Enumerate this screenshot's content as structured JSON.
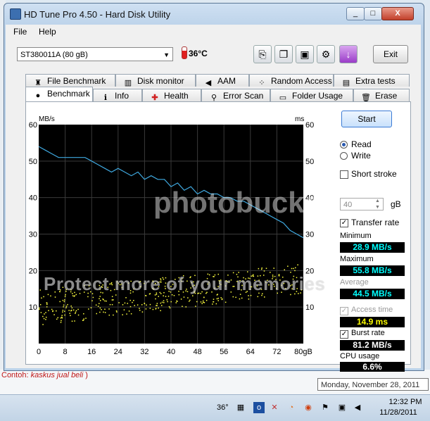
{
  "window": {
    "title": "HD Tune Pro 4.50 - Hard Disk Utility",
    "minimize_glyph": "_",
    "maximize_glyph": "□",
    "close_glyph": "X"
  },
  "menu": {
    "file": "File",
    "help": "Help"
  },
  "toolbar": {
    "drive": "ST380011A (80 gB)",
    "temperature": "36°C",
    "exit_label": "Exit",
    "icons": [
      "copy-icon",
      "copy-screen-icon",
      "save-icon",
      "options-icon",
      "download-icon"
    ]
  },
  "tabs": {
    "top_row": [
      "File Benchmark",
      "Disk monitor",
      "AAM",
      "Random Access",
      "Extra tests"
    ],
    "bottom_row": [
      "Benchmark",
      "Info",
      "Health",
      "Error Scan",
      "Folder Usage",
      "Erase"
    ],
    "active": "Benchmark"
  },
  "side_panel": {
    "start_label": "Start",
    "read_label": "Read",
    "write_label": "Write",
    "read_selected": true,
    "short_stroke_label": "Short stroke",
    "short_stroke_value": "40",
    "short_stroke_unit": "gB",
    "transfer_rate_label": "Transfer rate",
    "minimum_label": "Minimum",
    "minimum_value": "28.9 MB/s",
    "maximum_label": "Maximum",
    "maximum_value": "55.8 MB/s",
    "average_label": "Average",
    "average_value": "44.5 MB/s",
    "access_time_label": "Access time",
    "access_time_value": "14.9 ms",
    "burst_rate_label": "Burst rate",
    "burst_rate_value": "81.2 MB/s",
    "cpu_usage_label": "CPU usage",
    "cpu_usage_value": "6.6%",
    "value_color_cyan": "#00ffff",
    "value_color_yellow": "#ffff00",
    "value_color_white": "#ffffff"
  },
  "chart_data": {
    "type": "line",
    "ylabel": "MB/s",
    "ylabel_right": "ms",
    "x_ticks": [
      "0",
      "8",
      "16",
      "24",
      "32",
      "40",
      "48",
      "56",
      "64",
      "72",
      "80gB"
    ],
    "y_ticks": [
      "60",
      "50",
      "40",
      "30",
      "20",
      "10"
    ],
    "y_ticks_right": [
      "60",
      "50",
      "40",
      "30",
      "20",
      "10"
    ],
    "ylim": [
      0,
      60
    ],
    "xlim": [
      0,
      80
    ],
    "grid": true,
    "series": [
      {
        "color": "#3fa9e0",
        "x": [
          0,
          2,
          4,
          6,
          8,
          10,
          12,
          14,
          16,
          18,
          20,
          22,
          24,
          26,
          28,
          30,
          32,
          34,
          36,
          38,
          40,
          42,
          44,
          46,
          48,
          50,
          52,
          54,
          56,
          58,
          60,
          62,
          64,
          66,
          68,
          70,
          72,
          74,
          76,
          78,
          80
        ],
        "y": [
          54,
          53,
          52,
          51,
          51,
          51,
          51,
          51,
          50,
          49,
          48,
          47,
          48,
          47,
          46,
          47,
          45,
          46,
          45,
          45,
          43,
          44,
          42,
          43,
          41,
          42,
          41,
          41,
          40,
          40,
          39,
          39,
          38,
          37,
          36,
          35,
          34,
          33,
          31,
          30,
          29
        ]
      }
    ],
    "scatter": {
      "color": "#ffff40",
      "x_range": [
        0,
        80
      ],
      "y_range_start": [
        5,
        15
      ],
      "y_range_end": [
        14,
        22
      ]
    }
  },
  "taskbar": {
    "temperature": "36°",
    "time": "12:32 PM",
    "date": "11/28/2011",
    "tooltip": "Monday, November 28, 2011"
  },
  "background_page": {
    "snippet_prefix": "Contoh: ",
    "snippet_italic": "kaskus jual beli",
    "snippet_suffix": " )"
  },
  "watermark": {
    "logo_text": "photobucket",
    "text": "Protect more of your memories"
  }
}
